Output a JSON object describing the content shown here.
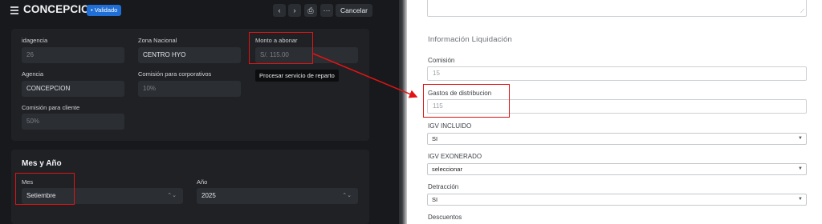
{
  "header": {
    "title": "CONCEPCION",
    "badge": "• Validado",
    "cancel_label": "Cancelar",
    "prev_icon": "‹",
    "next_icon": "›",
    "print_icon": "⎙",
    "more_icon": "···"
  },
  "form": {
    "idagencia": {
      "label": "idagencia",
      "value": "26"
    },
    "zona_nacional": {
      "label": "Zona Nacional",
      "value": "CENTRO HYO"
    },
    "monto_abonar": {
      "label": "Monto a abonar",
      "value": "S/. 115.00"
    },
    "agencia": {
      "label": "Agencia",
      "value": "CONCEPCION"
    },
    "comision_corporativos": {
      "label": "Comisión para corporativos",
      "value": "10%"
    },
    "comision_cliente": {
      "label": "Comisión para cliente",
      "value": "50%"
    }
  },
  "tooltip": "Procesar servicio de reparto",
  "mes_ano": {
    "title": "Mes y Año",
    "mes": {
      "label": "Mes",
      "value": "Setiembre"
    },
    "ano": {
      "label": "Año",
      "value": "2025"
    },
    "updown_icon": "⌃⌄"
  },
  "liquidacion": {
    "title": "Información Liquidación",
    "comision": {
      "label": "Comisión",
      "value": "15"
    },
    "gastos": {
      "label": "Gastos de distribucion",
      "value": "115"
    },
    "igv_incluido": {
      "label": "IGV INCLUIDO",
      "value": "SI"
    },
    "igv_exonerado": {
      "label": "IGV EXONERADO",
      "value": "seleccionar"
    },
    "detraccion": {
      "label": "Detracción",
      "value": "SI"
    },
    "descuentos": {
      "label": "Descuentos"
    },
    "dropdown_icon": "▼",
    "resize_icon": "⟋"
  },
  "colors": {
    "highlight": "#e01414",
    "badge": "#1f6fd6"
  }
}
